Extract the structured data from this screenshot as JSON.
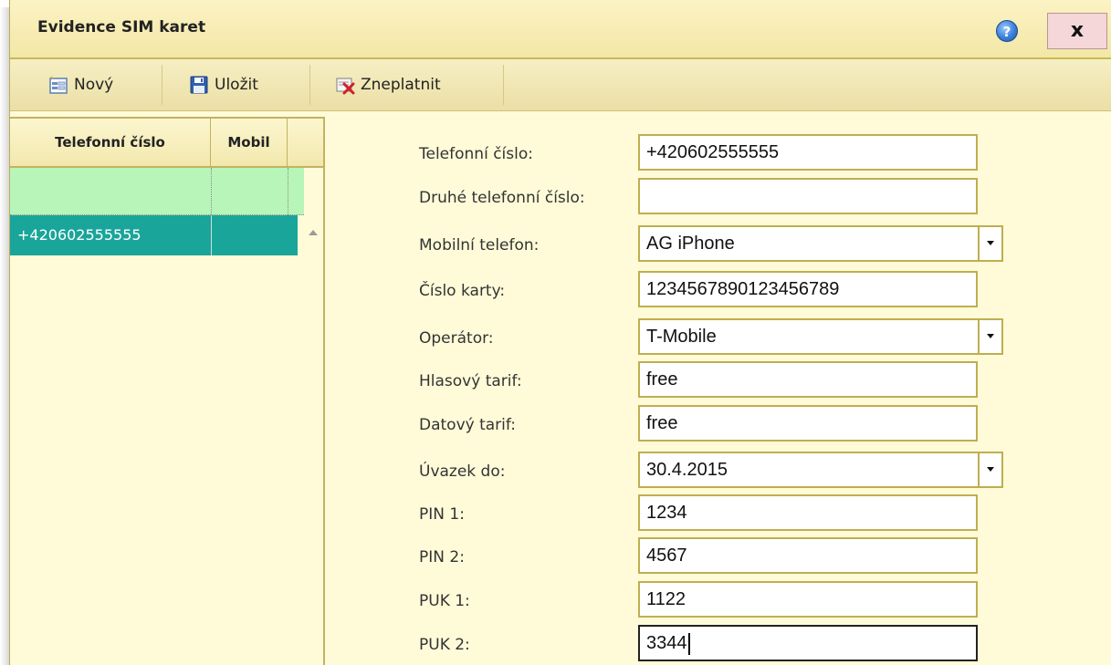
{
  "window": {
    "title": "Evidence SIM karet",
    "help_label": "?",
    "close_label": "x"
  },
  "toolbar": {
    "new_label": "Nový",
    "save_label": "Uložit",
    "invalidate_label": "Zneplatnit"
  },
  "grid": {
    "columns": [
      "Telefonní číslo",
      "Mobil"
    ],
    "rows": [
      {
        "phone": "+420602555555",
        "mobile": ""
      }
    ]
  },
  "form": {
    "fields": [
      {
        "label": "Telefonní číslo:",
        "value": "+420602555555",
        "type": "text"
      },
      {
        "label": "Druhé telefonní číslo:",
        "value": "",
        "type": "text"
      },
      {
        "label": "Mobilní telefon:",
        "value": "AG iPhone",
        "type": "select"
      },
      {
        "label": "Číslo karty:",
        "value": "1234567890123456789",
        "type": "text"
      },
      {
        "label": "Operátor:",
        "value": "T-Mobile",
        "type": "select"
      },
      {
        "label": "Hlasový tarif:",
        "value": "free",
        "type": "text"
      },
      {
        "label": "Datový tarif:",
        "value": "free",
        "type": "text"
      },
      {
        "label": "Úvazek do:",
        "value": "30.4.2015",
        "type": "select"
      },
      {
        "label": "PIN 1:",
        "value": "1234",
        "type": "text"
      },
      {
        "label": "PIN 2:",
        "value": "4567",
        "type": "text"
      },
      {
        "label": "PUK 1:",
        "value": "1122",
        "type": "text"
      },
      {
        "label": "PUK 2:",
        "value": "3344",
        "type": "text",
        "focused": true
      }
    ]
  }
}
